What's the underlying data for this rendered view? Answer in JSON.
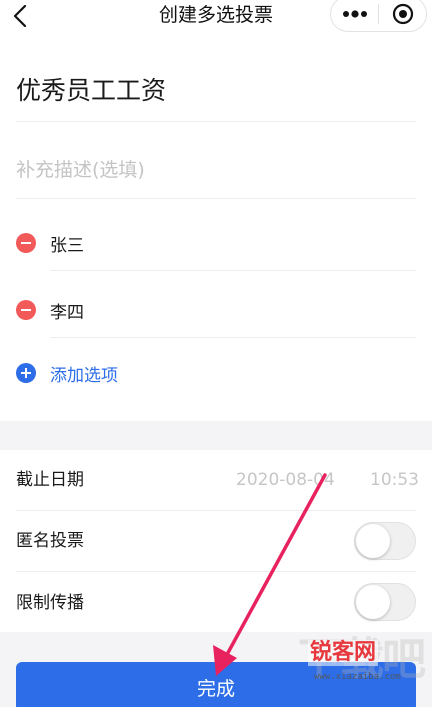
{
  "nav": {
    "title": "创建多选投票",
    "icons": [
      "back-icon",
      "more-icon",
      "close-icon"
    ]
  },
  "vote": {
    "title": "优秀员工工资",
    "description_placeholder": "补充描述(选填)",
    "options": [
      {
        "label": "张三"
      },
      {
        "label": "李四"
      }
    ],
    "add_option_label": "添加选项"
  },
  "settings": {
    "deadline_label": "截止日期",
    "deadline_date": "2020-08-04",
    "deadline_time": "10:53",
    "anonymous_label": "匿名投票",
    "anonymous_on": false,
    "restrict_label": "限制传播",
    "restrict_on": false
  },
  "done_label": "完成",
  "watermark": {
    "bg_text": "下载吧",
    "brand": "锐客网",
    "url": "www.xiazaiba.com"
  },
  "colors": {
    "accent": "#2d6ee8",
    "danger": "#f25a5a",
    "arrow": "#e8215f"
  }
}
